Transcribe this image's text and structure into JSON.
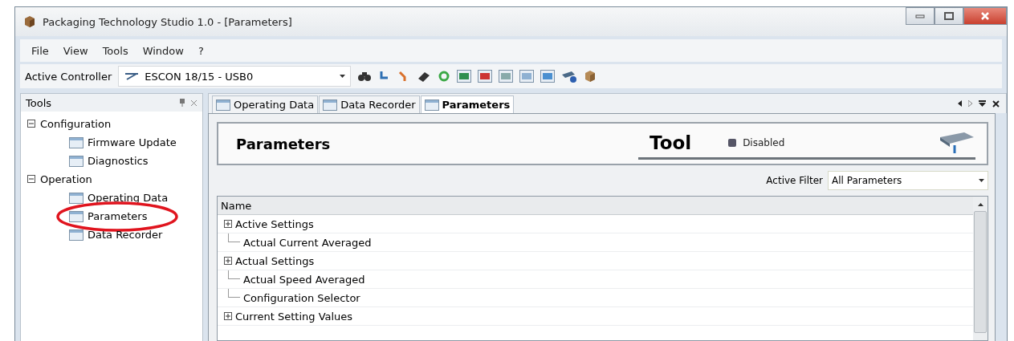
{
  "window": {
    "title": "Packaging Technology Studio 1.0 - [Parameters]"
  },
  "menu": [
    "File",
    "View",
    "Tools",
    "Window",
    "?"
  ],
  "toolbar": {
    "label": "Active Controller",
    "controller": "ESCON 18/15 - USB0"
  },
  "tools_panel": {
    "title": "Tools",
    "tree": [
      {
        "label": "Configuration",
        "expanded": true,
        "children": [
          {
            "label": "Firmware Update",
            "circled": false
          },
          {
            "label": "Diagnostics",
            "circled": false
          }
        ]
      },
      {
        "label": "Operation",
        "expanded": true,
        "children": [
          {
            "label": "Operating Data",
            "circled": false
          },
          {
            "label": "Parameters",
            "circled": true
          },
          {
            "label": "Data Recorder",
            "circled": false
          }
        ]
      }
    ]
  },
  "tabs": [
    {
      "label": "Operating Data",
      "selected": false
    },
    {
      "label": "Data Recorder",
      "selected": false
    },
    {
      "label": "Parameters",
      "selected": true
    }
  ],
  "header": {
    "title": "Parameters",
    "tool": "Tool",
    "status": "Disabled"
  },
  "filter": {
    "label": "Active Filter",
    "value": "All Parameters"
  },
  "table": {
    "columns": [
      "Name"
    ],
    "rows": [
      {
        "name": "Active Settings",
        "kind": "group",
        "expanded": false
      },
      {
        "name": "Actual Current Averaged",
        "kind": "leaf"
      },
      {
        "name": "Actual Settings",
        "kind": "group",
        "expanded": false
      },
      {
        "name": "Actual Speed Averaged",
        "kind": "leaf"
      },
      {
        "name": "Configuration Selector",
        "kind": "leaf"
      },
      {
        "name": "Current Setting Values",
        "kind": "group",
        "expanded": false
      }
    ]
  }
}
